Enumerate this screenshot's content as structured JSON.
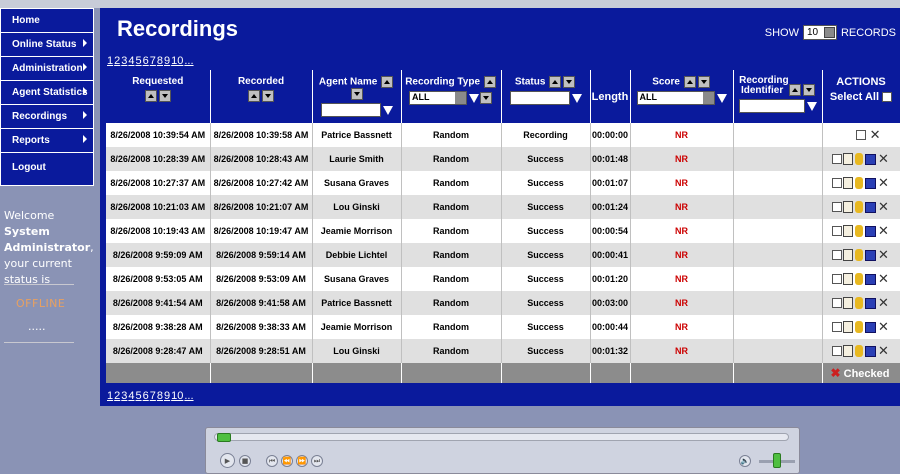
{
  "sidebar": {
    "items": [
      {
        "label": "Home",
        "arrow": false
      },
      {
        "label": "Online Status",
        "arrow": true
      },
      {
        "label": "Administration",
        "arrow": true
      },
      {
        "label": "Agent Statistics",
        "arrow": true
      },
      {
        "label": "Recordings",
        "arrow": true
      },
      {
        "label": "Reports",
        "arrow": true
      },
      {
        "label": "Logout",
        "arrow": false
      }
    ],
    "welcome_prefix": "Welcome",
    "user_name": "System Administrator",
    "status_text": ", your current status is",
    "status": "OFFLINE",
    "dots": "....."
  },
  "page": {
    "title": "Recordings",
    "show_label": "SHOW",
    "records_per_page": "10",
    "records_label": "RECORDS",
    "pagination": [
      "1",
      "2",
      "3",
      "4",
      "5",
      "6",
      "7",
      "8",
      "9",
      "10",
      "..."
    ]
  },
  "table": {
    "headers": {
      "requested": "Requested",
      "recorded": "Recorded",
      "agent_name": "Agent Name",
      "recording_type": "Recording Type",
      "recording_type_filter": "ALL",
      "status": "Status",
      "length": "Length",
      "score": "Score",
      "score_filter": "ALL",
      "recording_identifier": "Recording Identifier",
      "actions": "ACTIONS",
      "select_all": "Select All"
    },
    "rows": [
      {
        "requested": "8/26/2008 10:39:54 AM",
        "recorded": "8/26/2008 10:39:58 AM",
        "agent": "Patrice Bassnett",
        "type": "Random",
        "status": "Recording",
        "length": "00:00:00",
        "score": "NR",
        "identifier": ""
      },
      {
        "requested": "8/26/2008 10:28:39 AM",
        "recorded": "8/26/2008 10:28:43 AM",
        "agent": "Laurie Smith",
        "type": "Random",
        "status": "Success",
        "length": "00:01:48",
        "score": "NR",
        "identifier": ""
      },
      {
        "requested": "8/26/2008 10:27:37 AM",
        "recorded": "8/26/2008 10:27:42 AM",
        "agent": "Susana Graves",
        "type": "Random",
        "status": "Success",
        "length": "00:01:07",
        "score": "NR",
        "identifier": ""
      },
      {
        "requested": "8/26/2008 10:21:03 AM",
        "recorded": "8/26/2008 10:21:07 AM",
        "agent": "Lou Ginski",
        "type": "Random",
        "status": "Success",
        "length": "00:01:24",
        "score": "NR",
        "identifier": ""
      },
      {
        "requested": "8/26/2008 10:19:43 AM",
        "recorded": "8/26/2008 10:19:47 AM",
        "agent": "Jeamie Morrison",
        "type": "Random",
        "status": "Success",
        "length": "00:00:54",
        "score": "NR",
        "identifier": ""
      },
      {
        "requested": "8/26/2008 9:59:09 AM",
        "recorded": "8/26/2008 9:59:14 AM",
        "agent": "Debbie Lichtel",
        "type": "Random",
        "status": "Success",
        "length": "00:00:41",
        "score": "NR",
        "identifier": ""
      },
      {
        "requested": "8/26/2008 9:53:05 AM",
        "recorded": "8/26/2008 9:53:09 AM",
        "agent": "Susana Graves",
        "type": "Random",
        "status": "Success",
        "length": "00:01:20",
        "score": "NR",
        "identifier": ""
      },
      {
        "requested": "8/26/2008 9:41:54 AM",
        "recorded": "8/26/2008 9:41:58 AM",
        "agent": "Patrice Bassnett",
        "type": "Random",
        "status": "Success",
        "length": "00:03:00",
        "score": "NR",
        "identifier": ""
      },
      {
        "requested": "8/26/2008 9:38:28 AM",
        "recorded": "8/26/2008 9:38:33 AM",
        "agent": "Jeamie Morrison",
        "type": "Random",
        "status": "Success",
        "length": "00:00:44",
        "score": "NR",
        "identifier": ""
      },
      {
        "requested": "8/26/2008 9:28:47 AM",
        "recorded": "8/26/2008 9:28:51 AM",
        "agent": "Lou Ginski",
        "type": "Random",
        "status": "Success",
        "length": "00:01:32",
        "score": "NR",
        "identifier": ""
      }
    ],
    "footer_checked_label": "Checked"
  },
  "player": {
    "progress": 0.0,
    "volume": 0.5
  },
  "colors": {
    "panel_blue": "#0a1a9c",
    "score_red": "#cc0000",
    "offline_orange": "#e8a060"
  }
}
